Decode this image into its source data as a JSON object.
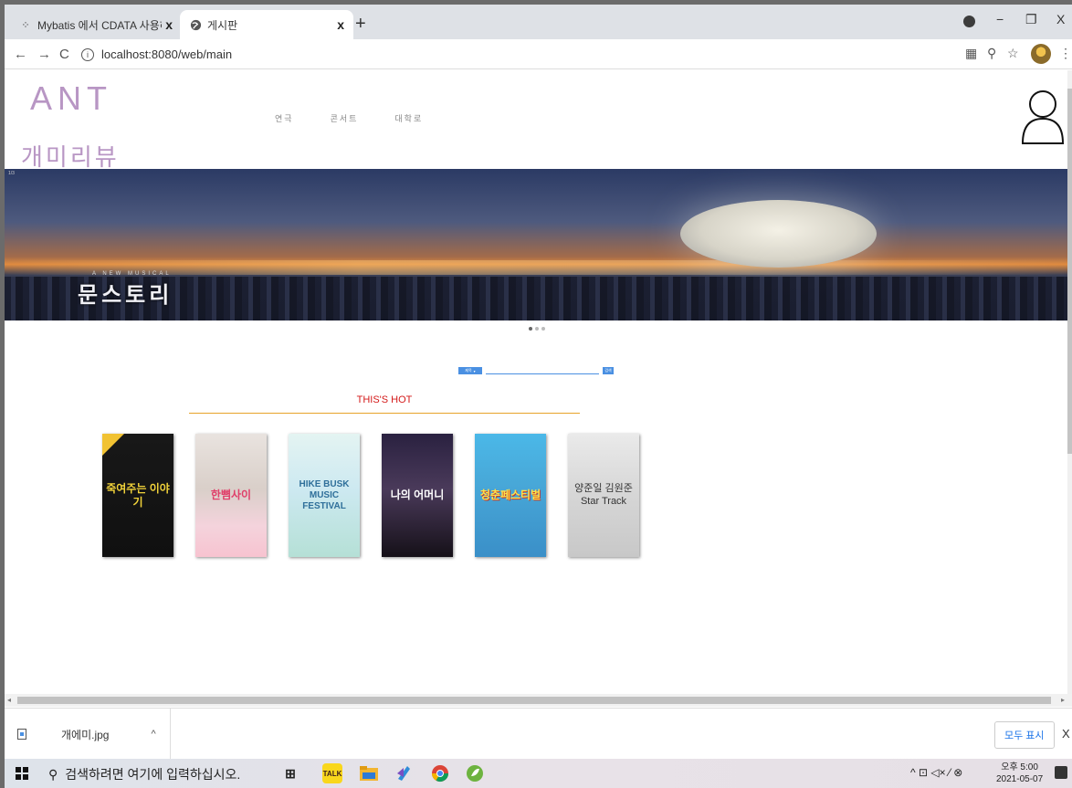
{
  "browser": {
    "tabs": [
      {
        "title": "Mybatis 에서 CDATA 사용하기 :",
        "close": "x",
        "active": false
      },
      {
        "title": "게시판",
        "close": "x",
        "active": true
      }
    ],
    "new_tab": "+",
    "window_controls": {
      "minimize": "−",
      "restore": "❐",
      "close": "X"
    },
    "nav": {
      "back": "←",
      "forward": "→",
      "reload": "C"
    },
    "url": "localhost:8080/web/main",
    "info_icon": "i",
    "right_icons": {
      "qr": "▦",
      "zoom": "⚲",
      "star": "☆",
      "menu": "⋮"
    }
  },
  "site": {
    "logo_en": "ANT",
    "logo_kr": "개미리뷰",
    "nav": [
      "연극",
      "콘서트",
      "대학로"
    ],
    "banner": {
      "counter": "1/3",
      "subtitle": "A NEW MUSICAL",
      "title": "문스토리"
    },
    "search": {
      "select_value": "제목",
      "button": "검색",
      "placeholder": ""
    },
    "hot_title": "THIS'S HOT",
    "posters": [
      {
        "title": "죽여주는 이야기"
      },
      {
        "title": "한뼘사이"
      },
      {
        "title": "HIKE BUSK MUSIC FESTIVAL"
      },
      {
        "title": "나의 어머니"
      },
      {
        "title": "청춘페스티벌"
      },
      {
        "title": "양준일 김원준 Star Track"
      }
    ]
  },
  "downloads": {
    "file": "개에미.jpg",
    "chevron": "^",
    "show_all": "모두 표시",
    "close": "X"
  },
  "taskbar": {
    "search_placeholder": "검색하려면 여기에 입력하십시오.",
    "tray_icons": "^ ⊡ ◁× ⁄ ⊗",
    "time": "오후 5:00",
    "date": "2021-05-07"
  },
  "colors": {
    "logo": "#b896c4",
    "hot_title": "#d41a1a",
    "hot_underline": "#e8a32a",
    "search_accent": "#4a90e2"
  }
}
